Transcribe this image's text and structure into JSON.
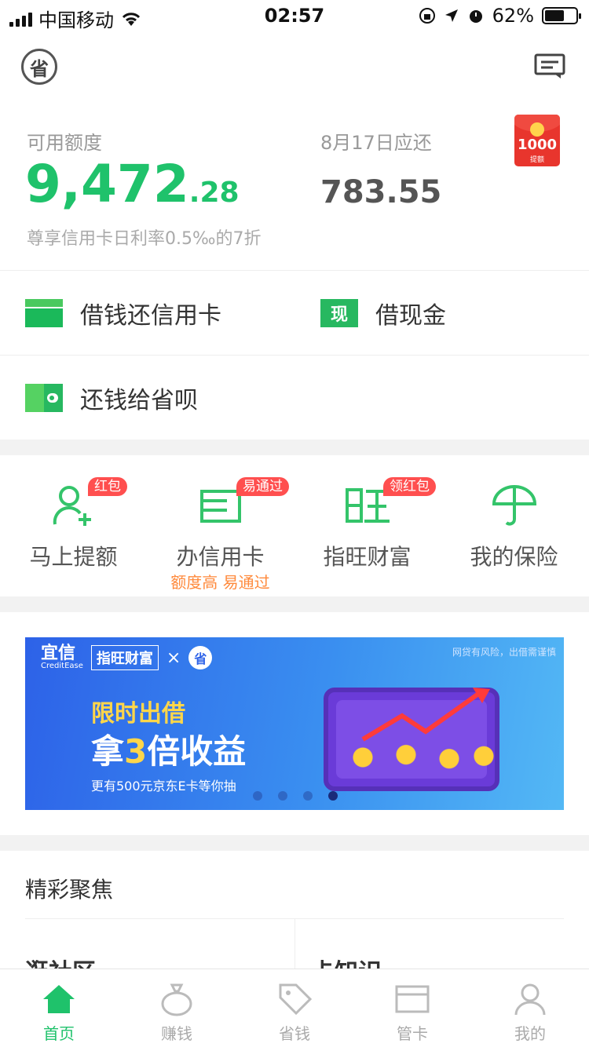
{
  "status_bar": {
    "carrier": "中国移动",
    "time": "02:57",
    "battery": "62%",
    "battery_level": 0.62
  },
  "header": {
    "logo_char": "省"
  },
  "credit": {
    "label": "可用额度",
    "amount_int": "9,472",
    "amount_dec": ".28",
    "note": "尊享信用卡日利率0.5‰的7折"
  },
  "repay": {
    "label": "8月17日应还",
    "amount": "783.55"
  },
  "red_packet": {
    "amount": "1000",
    "sub": "提额"
  },
  "actions": [
    {
      "label": "借钱还信用卡"
    },
    {
      "label": "借现金",
      "icon_text": "现"
    },
    {
      "label": "还钱给省呗"
    }
  ],
  "services": [
    {
      "label": "马上提额",
      "tag": "红包",
      "icon": "person-add-icon"
    },
    {
      "label": "办信用卡",
      "tag": "易通过",
      "sub": "额度高 易通过",
      "icon": "credit-card-icon"
    },
    {
      "label": "指旺财富",
      "tag": "领红包",
      "icon": "wang-icon"
    },
    {
      "label": "我的保险",
      "icon": "umbrella-icon"
    }
  ],
  "banner": {
    "brand1": "宜信",
    "brand1_sub": "CreditEase",
    "brand2": "指旺财富",
    "cross": "×",
    "brand3": "省",
    "ad": "网贷有风险，出借需谨慎",
    "line1": "限时出借",
    "line2_pre": "拿",
    "line2_hi": "3",
    "line2_post": "倍收益",
    "line3": "更有500元京东E卡等你抽",
    "active_dot": 4
  },
  "focus": {
    "title": "精彩聚焦",
    "items": [
      {
        "label": "逛社区"
      },
      {
        "label": "卡知识"
      }
    ]
  },
  "tabs": [
    {
      "label": "首页",
      "icon": "home-icon"
    },
    {
      "label": "赚钱",
      "icon": "money-bag-icon"
    },
    {
      "label": "省钱",
      "icon": "tag-icon"
    },
    {
      "label": "管卡",
      "icon": "card-icon"
    },
    {
      "label": "我的",
      "icon": "profile-icon"
    }
  ],
  "colors": {
    "accent_green": "#1fc26b",
    "tag_red": "#ff4f4f",
    "sub_orange": "#ff8a3c"
  }
}
